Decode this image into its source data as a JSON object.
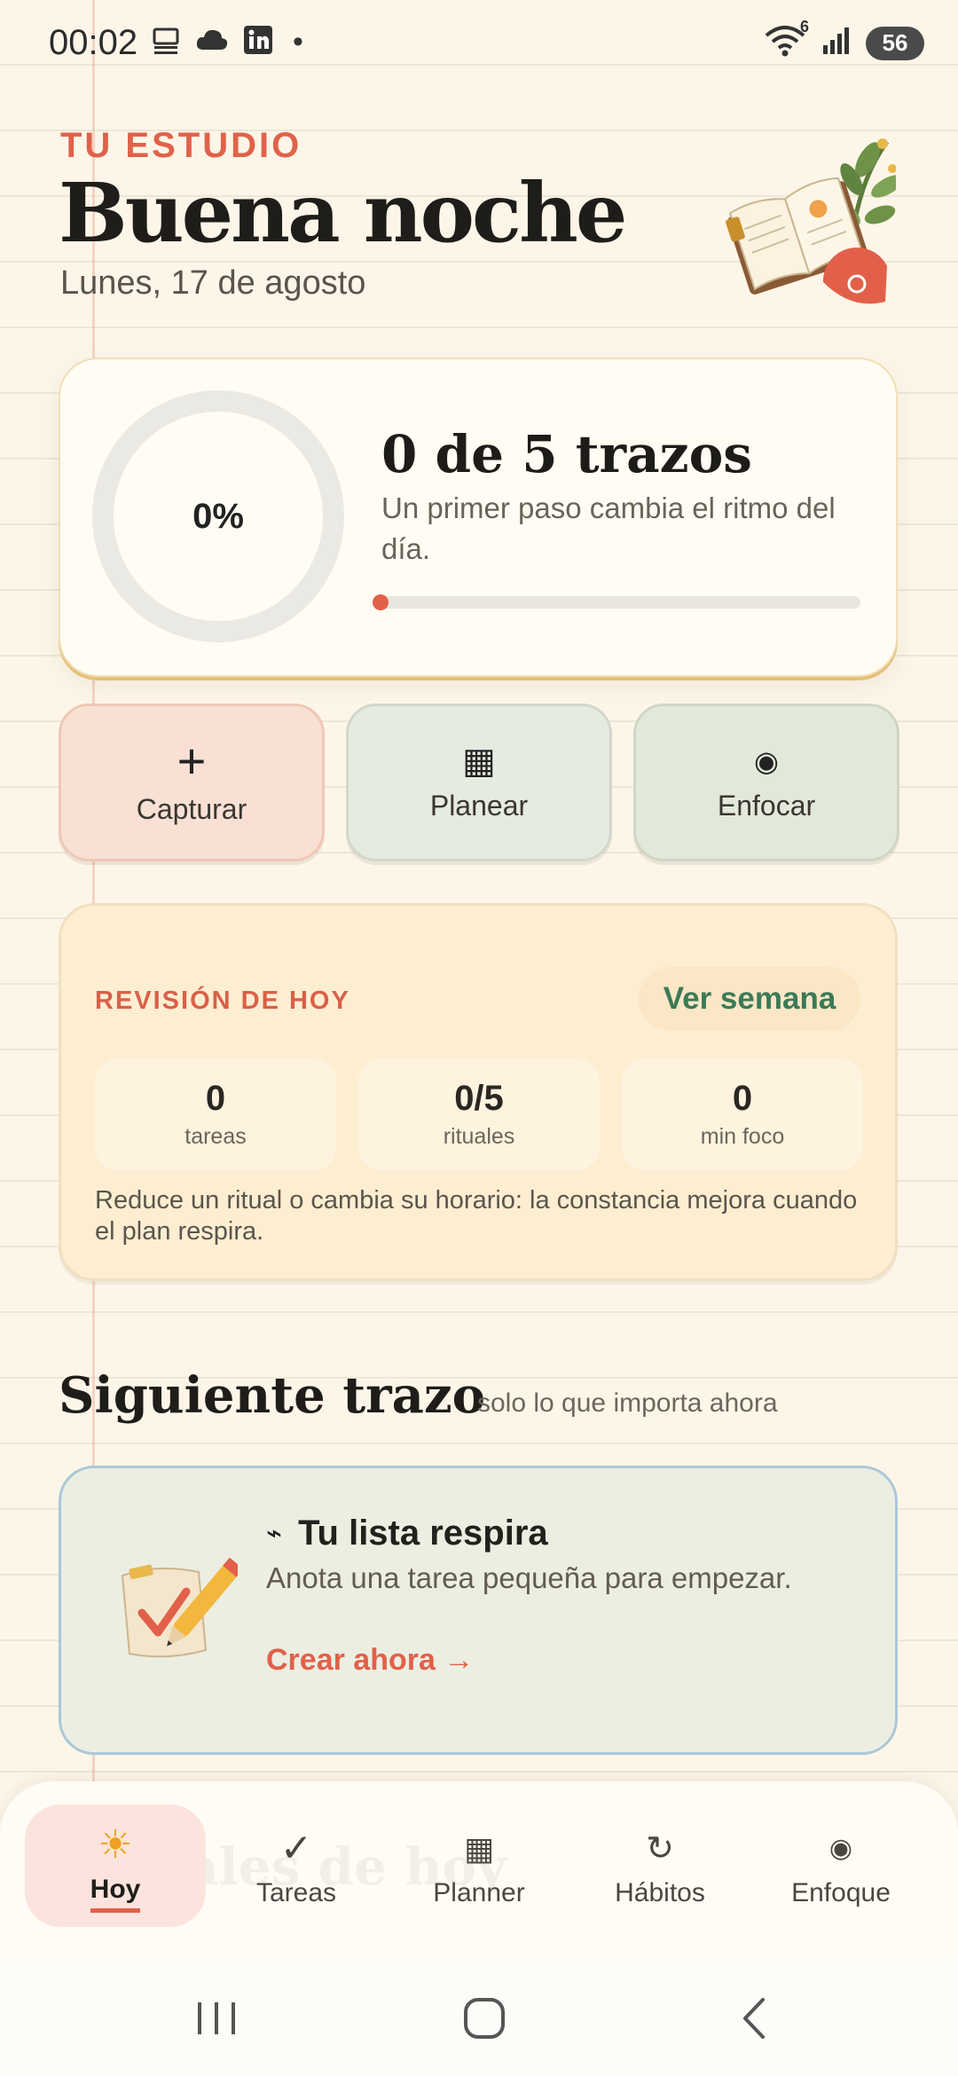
{
  "status_bar": {
    "time": "00:02",
    "dot": "•",
    "left_icons": [
      "desktop-icon",
      "cloud-icon",
      "linkedin-icon"
    ],
    "wifi_badge": "6",
    "battery": "56"
  },
  "header": {
    "eyebrow": "TU ESTUDIO",
    "greeting": "Buena noche",
    "date": "Lunes, 17 de agosto"
  },
  "progress": {
    "percent_label": "0%",
    "title": "0 de 5 trazos",
    "subtitle": "Un primer paso cambia el ritmo del día.",
    "value": 0
  },
  "quick_actions": [
    {
      "icon": "+",
      "label": "Capturar"
    },
    {
      "icon": "▦",
      "label": "Planear"
    },
    {
      "icon": "◉",
      "label": "Enfocar"
    }
  ],
  "review": {
    "title": "REVISIÓN DE HOY",
    "link": "Ver semana",
    "stats": [
      {
        "value": "0",
        "label": "tareas"
      },
      {
        "value": "0/5",
        "label": "rituales"
      },
      {
        "value": "0",
        "label": "min foco"
      }
    ],
    "note": "Reduce un ritual o cambia su horario: la constancia mejora cuando el plan respira."
  },
  "next": {
    "title": "Siguiente trazo",
    "subtitle": "solo lo que importa ahora",
    "empty_icon": "⌁",
    "empty_title": "Tu lista respira",
    "empty_sub": "Anota una tarea pequeña para empezar.",
    "empty_link": "Crear ahora →"
  },
  "ghost_text": "Rituales de hoy",
  "nav": [
    {
      "icon": "☀",
      "label": "Hoy",
      "active": true
    },
    {
      "icon": "✓",
      "label": "Tareas"
    },
    {
      "icon": "▦",
      "label": "Planner"
    },
    {
      "icon": "↻",
      "label": "Hábitos"
    },
    {
      "icon": "◉",
      "label": "Enfoque"
    }
  ],
  "colors": {
    "accent": "#e2604a",
    "green_link": "#3b7a57",
    "background": "#fdf6e8"
  }
}
